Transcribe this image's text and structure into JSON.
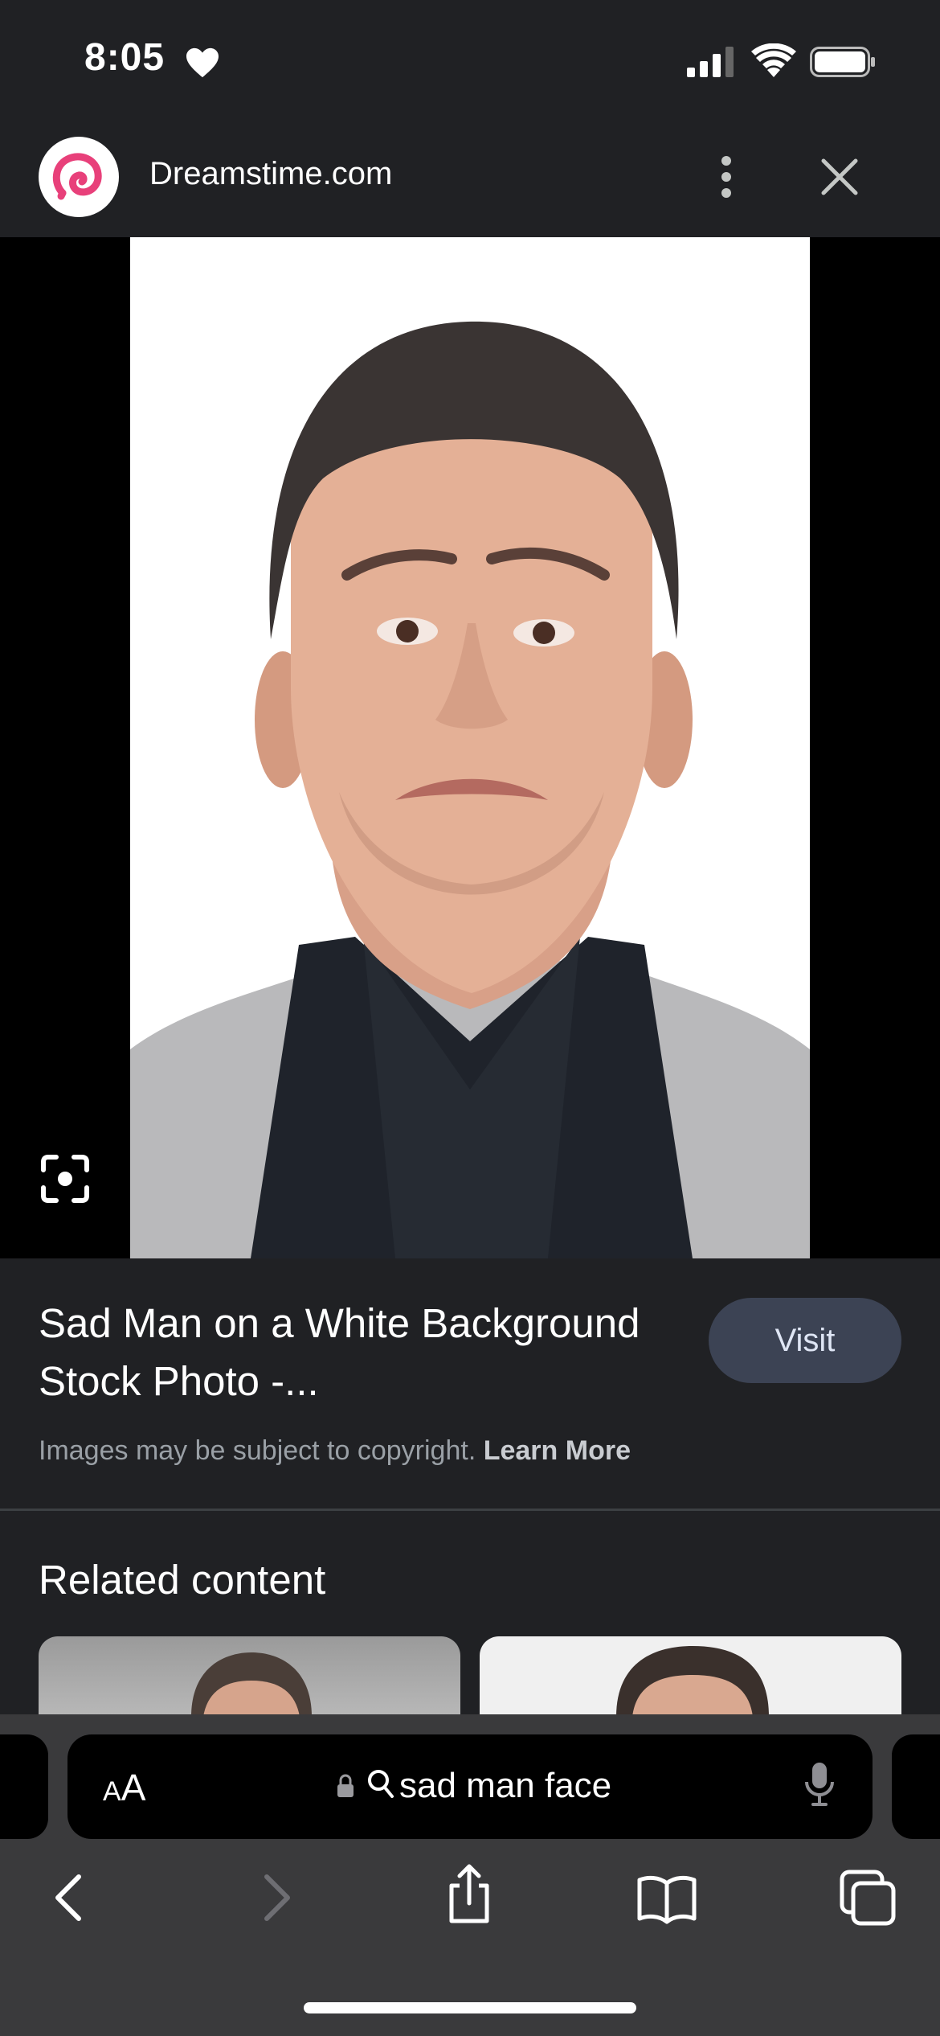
{
  "status_bar": {
    "time": "8:05"
  },
  "source": {
    "site_name": "Dreamstime.com"
  },
  "result": {
    "title": "Sad Man on a White Background Stock Photo -...",
    "visit_label": "Visit",
    "copyright_text": "Images may be subject to copyright.",
    "learn_more": "Learn More"
  },
  "related": {
    "heading": "Related content"
  },
  "browser": {
    "text_size_small": "A",
    "text_size_large": "A",
    "address": "sad man face"
  },
  "colors": {
    "logo_accent": "#e8407a",
    "visit_bg": "#3c4354",
    "background": "#202124"
  }
}
